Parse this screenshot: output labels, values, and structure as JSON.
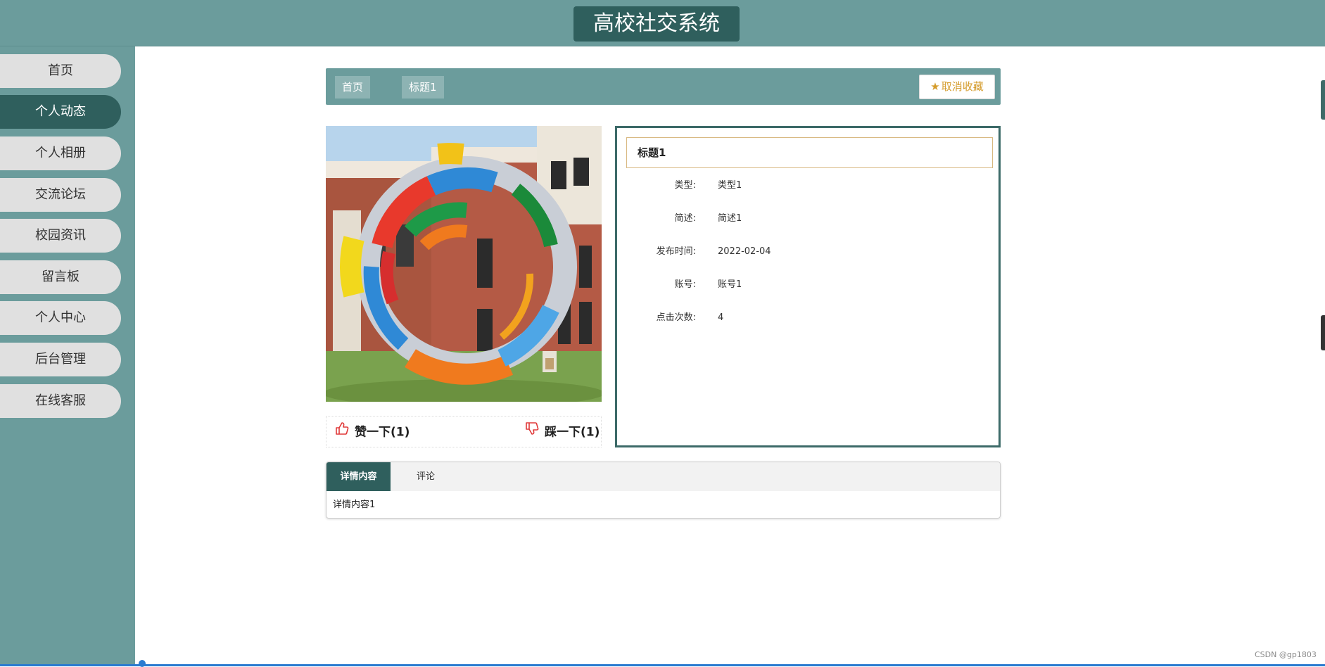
{
  "header": {
    "title": "高校社交系统"
  },
  "sidebar": {
    "items": [
      {
        "label": "首页"
      },
      {
        "label": "个人动态",
        "active": true
      },
      {
        "label": "个人相册"
      },
      {
        "label": "交流论坛"
      },
      {
        "label": "校园资讯"
      },
      {
        "label": "留言板"
      },
      {
        "label": "个人中心"
      },
      {
        "label": "后台管理"
      },
      {
        "label": "在线客服"
      }
    ]
  },
  "breadcrumb": {
    "home": "首页",
    "current": "标题1"
  },
  "favorite": {
    "label": "取消收藏",
    "icon": "star-icon"
  },
  "votes": {
    "like": {
      "label": "赞一下(1)",
      "icon": "thumbs-up-icon"
    },
    "dislike": {
      "label": "踩一下(1)",
      "icon": "thumbs-down-icon"
    }
  },
  "detail": {
    "title": "标题1",
    "rows": [
      {
        "label": "类型:",
        "value": "类型1"
      },
      {
        "label": "简述:",
        "value": "简述1"
      },
      {
        "label": "发布时间:",
        "value": "2022-02-04"
      },
      {
        "label": "账号:",
        "value": "账号1"
      },
      {
        "label": "点击次数:",
        "value": "4"
      }
    ]
  },
  "tabs": {
    "items": [
      {
        "label": "详情内容",
        "active": true
      },
      {
        "label": "评论"
      }
    ],
    "content": "详情内容1"
  },
  "watermark": "CSDN @gp1803",
  "colors": {
    "primary": "#6b9c9c",
    "dark": "#2f5f5d",
    "accent": "#d49b2a",
    "vote": "#e03a3a"
  }
}
